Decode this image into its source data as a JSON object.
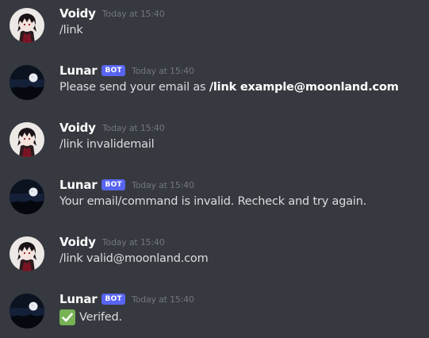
{
  "messages": [
    {
      "author": "Voidy",
      "avatar_icon": "anime-character-avatar-icon",
      "is_bot": false,
      "timestamp": "Today at 15:40",
      "text": "/link"
    },
    {
      "author": "Lunar",
      "avatar_icon": "moon-night-avatar-icon",
      "is_bot": true,
      "bot_tag": "BOT",
      "timestamp": "Today at 15:40",
      "text": "Please send your email as ",
      "text_bold": "/link example@moonland.com"
    },
    {
      "author": "Voidy",
      "avatar_icon": "anime-character-avatar-icon",
      "is_bot": false,
      "timestamp": "Today at 15:40",
      "text": "/link invalidemail"
    },
    {
      "author": "Lunar",
      "avatar_icon": "moon-night-avatar-icon",
      "is_bot": true,
      "bot_tag": "BOT",
      "timestamp": "Today at 15:40",
      "text": "Your email/command is invalid. Recheck and try again."
    },
    {
      "author": "Voidy",
      "avatar_icon": "anime-character-avatar-icon",
      "is_bot": false,
      "timestamp": "Today at 15:40",
      "text": "/link valid@moonland.com"
    },
    {
      "author": "Lunar",
      "avatar_icon": "moon-night-avatar-icon",
      "is_bot": true,
      "bot_tag": "BOT",
      "timestamp": "Today at 15:40",
      "emoji": "check-mark-icon",
      "text": "Verifed."
    }
  ],
  "colors": {
    "background": "#36393f",
    "username": "#ffffff",
    "message_text": "#dcddde",
    "timestamp": "#72767d",
    "bot_tag": "#5865f2",
    "check_emoji": "#77b255"
  }
}
